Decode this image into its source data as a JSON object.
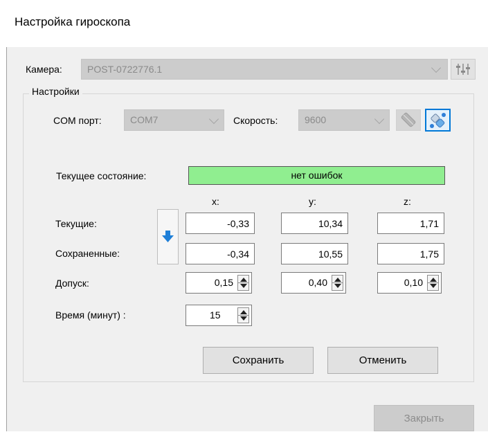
{
  "window": {
    "title": "Настройка гироскопа"
  },
  "camera": {
    "label": "Камера:",
    "value": "POST-0722776.1"
  },
  "settings": {
    "group_title": "Настройки",
    "com_label": "COM порт:",
    "com_value": "COM7",
    "speed_label": "Скорость:",
    "speed_value": "9600"
  },
  "status": {
    "label": "Текущее состояние:",
    "value": "нет ошибок",
    "color": "#90ee90"
  },
  "axes": {
    "x": "x:",
    "y": "y:",
    "z": "z:"
  },
  "current": {
    "label": "Текущие:",
    "x": "-0,33",
    "y": "10,34",
    "z": "1,71"
  },
  "saved": {
    "label": "Сохраненные:",
    "x": "-0,34",
    "y": "10,55",
    "z": "1,75"
  },
  "tolerance": {
    "label": "Допуск:",
    "x": "0,15",
    "y": "0,40",
    "z": "0,10"
  },
  "time": {
    "label": "Время (минут) :",
    "value": "15"
  },
  "buttons": {
    "save": "Сохранить",
    "cancel": "Отменить",
    "close": "Закрыть"
  },
  "icons": {
    "camera_settings": "sliders-icon",
    "disconnect": "plug-disconnected-icon",
    "connect": "plug-connected-icon",
    "copy": "arrow-down-icon"
  },
  "colors": {
    "accent": "#0078d7",
    "arrow": "#1e7fd8",
    "ok": "#90ee90"
  }
}
